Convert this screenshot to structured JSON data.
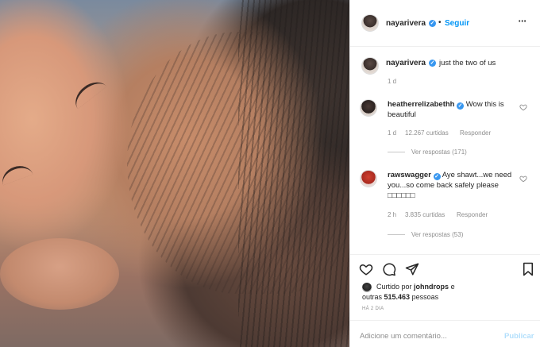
{
  "post": {
    "username": "nayarivera",
    "separator": "•",
    "follow_label": "Seguir",
    "more_label": "•••"
  },
  "caption": {
    "username": "nayarivera",
    "text": "just the two of us",
    "time": "1 d"
  },
  "comments": [
    {
      "username": "heatherrelizabethh",
      "text": "Wow this is beautiful",
      "time": "1 d",
      "likes": "12.267 curtidas",
      "reply": "Responder",
      "view_replies": "Ver respostas (171)"
    },
    {
      "username": "rawswagger",
      "text": "Aye shawt...we need you...so come back safely please",
      "emoji_tail": "□□□□□□",
      "time": "2 h",
      "likes": "3.835 curtidas",
      "reply": "Responder",
      "view_replies": "Ver respostas (53)"
    }
  ],
  "liked_by": {
    "prefix": "Curtido por",
    "user": "johndrops",
    "middle": "e",
    "line2_prefix": "outras",
    "count": "515.463",
    "suffix": "pessoas"
  },
  "date": "HÁ 2 DIA",
  "comment_box": {
    "placeholder": "Adicione um comentário...",
    "publish_label": "Publicar"
  },
  "icons": {
    "like": "heart-icon",
    "comment": "comment-icon",
    "share": "share-icon",
    "save": "bookmark-icon",
    "verified": "verified-badge-icon"
  },
  "colors": {
    "link": "#0095f6",
    "verified": "#3897f0",
    "muted": "#8e8e8e",
    "publish_disabled": "#b2dffc"
  }
}
